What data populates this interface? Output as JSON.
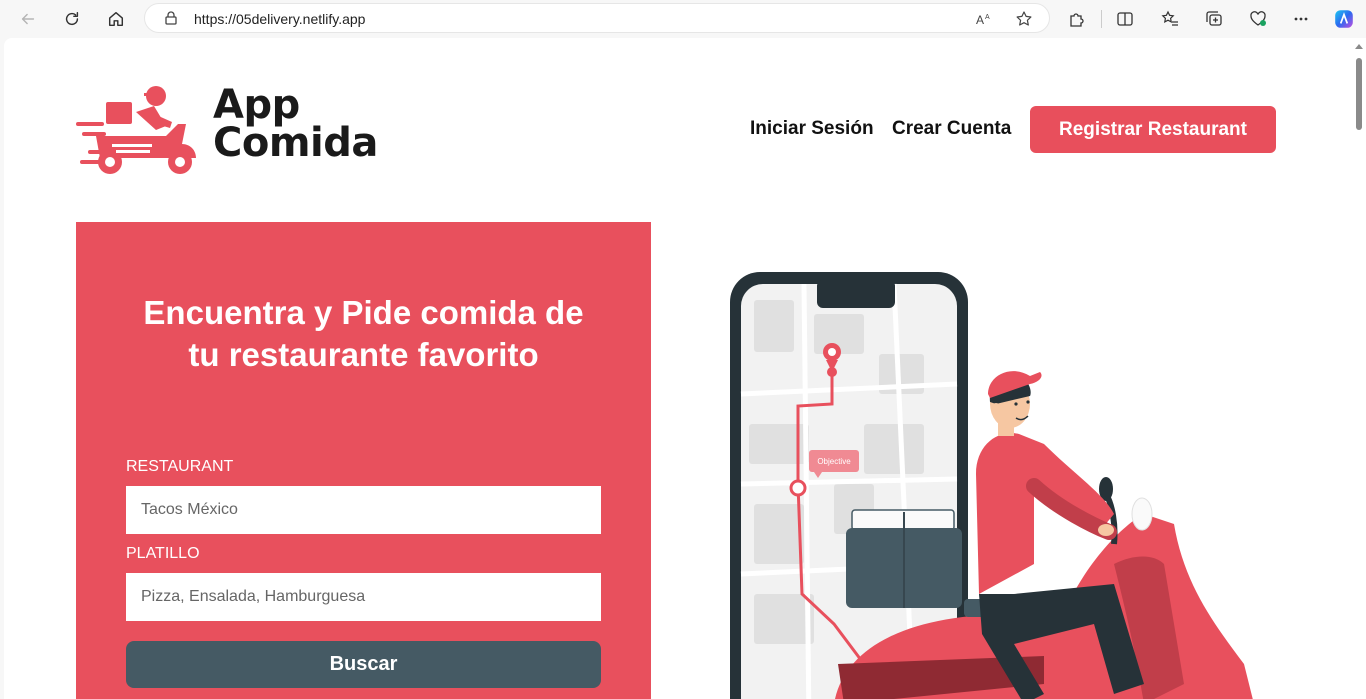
{
  "browser": {
    "url": "https://05delivery.netlify.app"
  },
  "header": {
    "logo_line1": "App",
    "logo_line2": "Comida",
    "nav": {
      "login": "Iniciar Sesión",
      "signup": "Crear Cuenta",
      "register_restaurant": "Registrar Restaurant"
    }
  },
  "hero": {
    "title_line1": "Encuentra y Pide comida de",
    "title_line2": "tu restaurante favorito",
    "restaurant_label": "RESTAURANT",
    "restaurant_placeholder": "Tacos México",
    "dish_label": "PLATILLO",
    "dish_placeholder": "Pizza, Ensalada, Hamburguesa",
    "search_button": "Buscar"
  },
  "illustration": {
    "map_tag": "Objective"
  },
  "colors": {
    "brand": "#e8505d",
    "dark": "#455a64",
    "text": "#1a1a1a"
  }
}
